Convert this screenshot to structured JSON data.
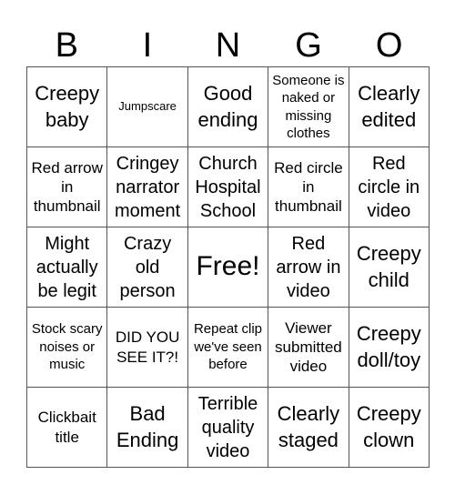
{
  "header": {
    "letters": [
      "B",
      "I",
      "N",
      "G",
      "O"
    ]
  },
  "cells": [
    {
      "text": "Creepy baby",
      "size": "s-xl"
    },
    {
      "text": "Jumpscare",
      "size": "s-xs"
    },
    {
      "text": "Good ending",
      "size": "s-xl"
    },
    {
      "text": "Someone is naked or missing clothes",
      "size": "s-s"
    },
    {
      "text": "Clearly edited",
      "size": "s-xl"
    },
    {
      "text": "Red arrow in thumbnail",
      "size": "s-m"
    },
    {
      "text": "Cringey narrator moment",
      "size": "s-l"
    },
    {
      "text": "Church Hospital School",
      "size": "s-l"
    },
    {
      "text": "Red circle in thumbnail",
      "size": "s-m"
    },
    {
      "text": "Red circle in video",
      "size": "s-l"
    },
    {
      "text": "Might actually be legit",
      "size": "s-l"
    },
    {
      "text": "Crazy old person",
      "size": "s-l"
    },
    {
      "text": "Free!",
      "size": "s-xxl"
    },
    {
      "text": "Red arrow in video",
      "size": "s-l"
    },
    {
      "text": "Creepy child",
      "size": "s-xl"
    },
    {
      "text": "Stock scary noises or music",
      "size": "s-s"
    },
    {
      "text": "DID YOU SEE IT?!",
      "size": "s-m"
    },
    {
      "text": "Repeat clip we've seen before",
      "size": "s-s"
    },
    {
      "text": "Viewer submitted video",
      "size": "s-m"
    },
    {
      "text": "Creepy doll/toy",
      "size": "s-xl"
    },
    {
      "text": "Clickbait title",
      "size": "s-m"
    },
    {
      "text": "Bad Ending",
      "size": "s-xl"
    },
    {
      "text": "Terrible quality video",
      "size": "s-l"
    },
    {
      "text": "Clearly staged",
      "size": "s-xl"
    },
    {
      "text": "Creepy clown",
      "size": "s-xl"
    }
  ]
}
